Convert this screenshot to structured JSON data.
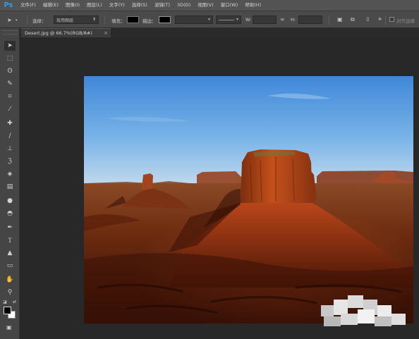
{
  "app": {
    "logo": "Ps"
  },
  "menu": [
    "文件(F)",
    "编辑(E)",
    "图像(I)",
    "图层(L)",
    "文字(Y)",
    "选择(S)",
    "滤镜(T)",
    "3D(D)",
    "视图(V)",
    "窗口(W)",
    "帮助(H)"
  ],
  "options": {
    "select_label": "选择：",
    "select_value": "现用图层",
    "fill_label": "填充：",
    "stroke_label": "描边：",
    "w_label": "W:",
    "h_label": "H:",
    "align_edges_label": "对齐边缘",
    "fill_color": "#000000",
    "stroke_color": "#000000"
  },
  "document": {
    "tab_title": "Desert.jpg @ 66.7%(RGB/8#)",
    "close_glyph": "×"
  },
  "tools": [
    {
      "name": "move-tool",
      "glyph": "➤"
    },
    {
      "name": "marquee-tool",
      "glyph": "⬚"
    },
    {
      "name": "lasso-tool",
      "glyph": "ʘ"
    },
    {
      "name": "quick-select-tool",
      "glyph": "✎"
    },
    {
      "name": "crop-tool",
      "glyph": "⌗"
    },
    {
      "name": "eyedropper-tool",
      "glyph": "⁄"
    },
    {
      "name": "healing-brush-tool",
      "glyph": "✚"
    },
    {
      "name": "brush-tool",
      "glyph": "∕"
    },
    {
      "name": "clone-stamp-tool",
      "glyph": "⊥"
    },
    {
      "name": "history-brush-tool",
      "glyph": "ℨ"
    },
    {
      "name": "eraser-tool",
      "glyph": "◈"
    },
    {
      "name": "gradient-tool",
      "glyph": "▤"
    },
    {
      "name": "blur-tool",
      "glyph": "●"
    },
    {
      "name": "dodge-tool",
      "glyph": "◓"
    },
    {
      "name": "pen-tool",
      "glyph": "✒"
    },
    {
      "name": "type-tool",
      "glyph": "T"
    },
    {
      "name": "path-selection-tool",
      "glyph": "▲"
    },
    {
      "name": "rectangle-tool",
      "glyph": "▭"
    },
    {
      "name": "hand-tool",
      "glyph": "✋"
    },
    {
      "name": "zoom-tool",
      "glyph": "⚲"
    }
  ],
  "colors": {
    "foreground": "#000000",
    "background": "#ffffff",
    "accent": "#31a8ff"
  }
}
